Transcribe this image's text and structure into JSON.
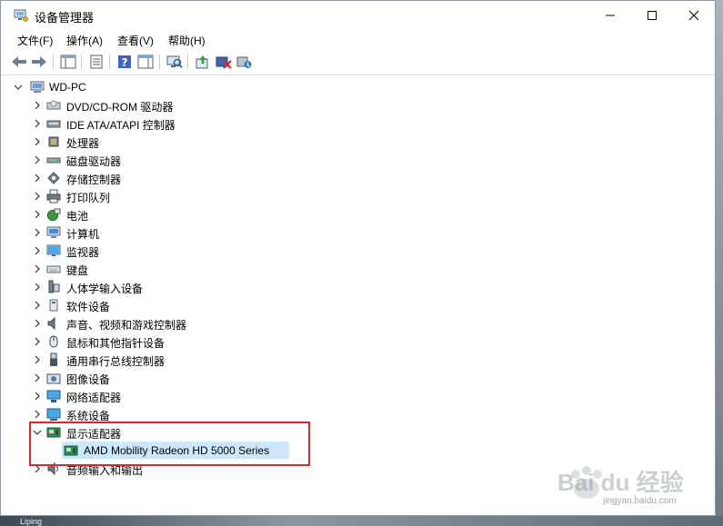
{
  "window": {
    "title": "设备管理器",
    "controls": [
      "minimize",
      "maximize",
      "close"
    ]
  },
  "menu": [
    {
      "label": "文件(F)"
    },
    {
      "label": "操作(A)"
    },
    {
      "label": "查看(V)"
    },
    {
      "label": "帮助(H)"
    }
  ],
  "toolbar": [
    {
      "name": "back-icon"
    },
    {
      "name": "forward-icon"
    },
    {
      "name": "show-hide-console-tree-icon"
    },
    {
      "name": "properties-icon"
    },
    {
      "name": "help-icon"
    },
    {
      "name": "action-pane-icon"
    },
    {
      "name": "scan-hardware-icon"
    },
    {
      "name": "update-driver-icon"
    },
    {
      "name": "uninstall-device-icon"
    },
    {
      "name": "add-legacy-hardware-icon"
    }
  ],
  "tree": {
    "root": "WD-PC",
    "categories": [
      {
        "label": "DVD/CD-ROM 驱动器",
        "icon": "dvd-drive-icon"
      },
      {
        "label": "IDE ATA/ATAPI 控制器",
        "icon": "ide-controller-icon"
      },
      {
        "label": "处理器",
        "icon": "processor-icon"
      },
      {
        "label": "磁盘驱动器",
        "icon": "disk-drive-icon"
      },
      {
        "label": "存储控制器",
        "icon": "storage-controller-icon"
      },
      {
        "label": "打印队列",
        "icon": "printer-icon"
      },
      {
        "label": "电池",
        "icon": "battery-icon"
      },
      {
        "label": "计算机",
        "icon": "computer-icon"
      },
      {
        "label": "监视器",
        "icon": "monitor-icon"
      },
      {
        "label": "键盘",
        "icon": "keyboard-icon"
      },
      {
        "label": "人体学输入设备",
        "icon": "hid-icon"
      },
      {
        "label": "软件设备",
        "icon": "software-device-icon"
      },
      {
        "label": "声音、视频和游戏控制器",
        "icon": "sound-icon"
      },
      {
        "label": "鼠标和其他指针设备",
        "icon": "mouse-icon"
      },
      {
        "label": "通用串行总线控制器",
        "icon": "usb-icon"
      },
      {
        "label": "图像设备",
        "icon": "camera-icon"
      },
      {
        "label": "网络适配器",
        "icon": "network-adapter-icon"
      },
      {
        "label": "系统设备",
        "icon": "system-device-icon"
      },
      {
        "label": "显示适配器",
        "icon": "display-adapter-icon",
        "expanded": true
      },
      {
        "label": "音频输入和输出",
        "icon": "audio-io-icon"
      }
    ],
    "expanded_child": {
      "label": "AMD Mobility Radeon HD 5000 Series",
      "icon": "display-adapter-icon"
    }
  },
  "watermark": {
    "brand": "Bai du 经验",
    "url": "jingyan.baidu.com"
  },
  "desktop": {
    "bottom_text": "Liping"
  },
  "colors": {
    "selection": "#cce8ff",
    "highlight_border": "#e0262b"
  }
}
